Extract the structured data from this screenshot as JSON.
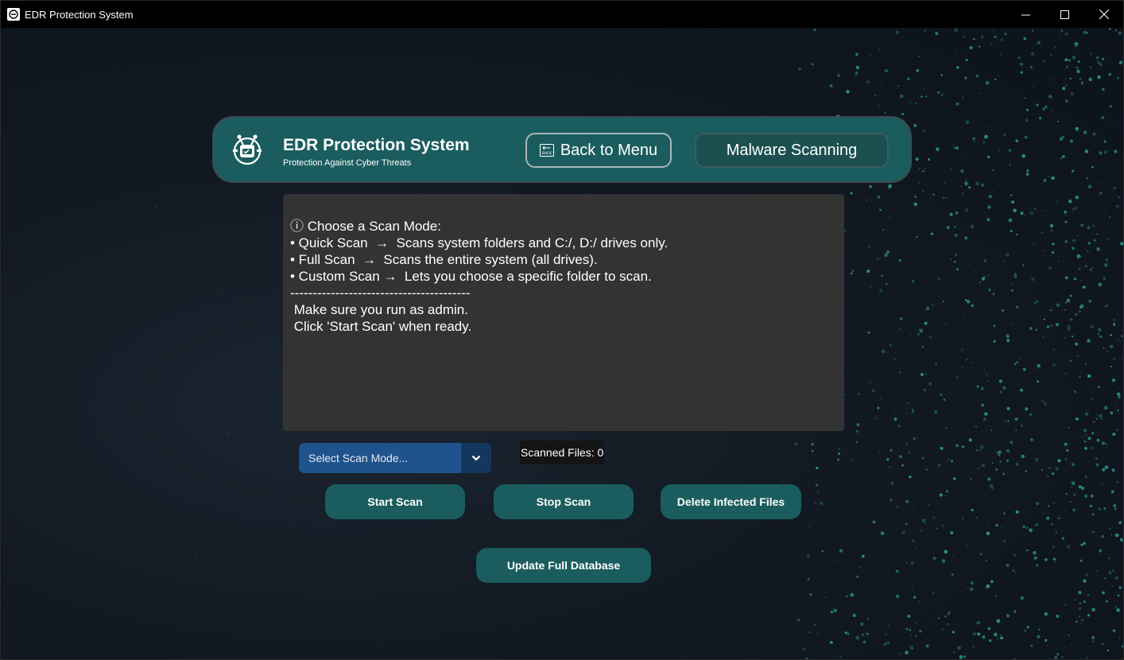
{
  "window": {
    "title": "EDR Protection System",
    "controls": [
      "minimize-icon",
      "maximize-icon",
      "close-icon"
    ]
  },
  "header": {
    "title": "EDR Protection System",
    "subtitle": "Protection Against Cyber Threats",
    "back_button": "Back to Menu",
    "back_icon_text": "BACK",
    "section_button": "Malware Scanning"
  },
  "info": {
    "lines": [
      "ⓘ Choose a Scan Mode:",
      "• Quick Scan  →  Scans system folders and C:/, D:/ drives only.",
      "• Full Scan  →  Scans the entire system (all drives).",
      "• Custom Scan →  Lets you choose a specific folder to scan.",
      "----------------------------------------",
      " Make sure you run as admin.",
      " Click 'Start Scan' when ready."
    ]
  },
  "scan_mode": {
    "selected": "Select Scan Mode..."
  },
  "status": {
    "scanned_files": "Scanned Files: 0"
  },
  "actions": {
    "start": "Start Scan",
    "stop": "Stop Scan",
    "delete": "Delete Infected Files",
    "update": "Update Full Database"
  },
  "colors": {
    "teal": "#1b5d5e",
    "dropdown": "#1f538d",
    "panel": "#333333",
    "background": "#121922",
    "dots": "#2fa79f"
  }
}
